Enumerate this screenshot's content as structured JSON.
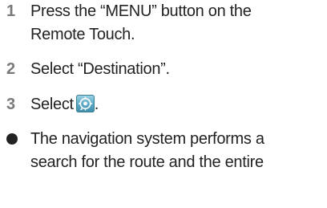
{
  "steps": [
    {
      "number": "1",
      "lines": [
        "Press the “MENU” button on the",
        "Remote Touch."
      ]
    },
    {
      "number": "2",
      "lines": [
        "Select “Destination”."
      ]
    },
    {
      "number": "3",
      "text_before_icon": "Select",
      "icon": "route-search-icon",
      "text_after_icon": "."
    }
  ],
  "bullet": {
    "lines": [
      "The navigation system performs a",
      "search for the route and the entire"
    ]
  },
  "colors": {
    "step_number": "#7a7a7a",
    "text": "#222222",
    "icon_bg": "#5aa8c4"
  }
}
